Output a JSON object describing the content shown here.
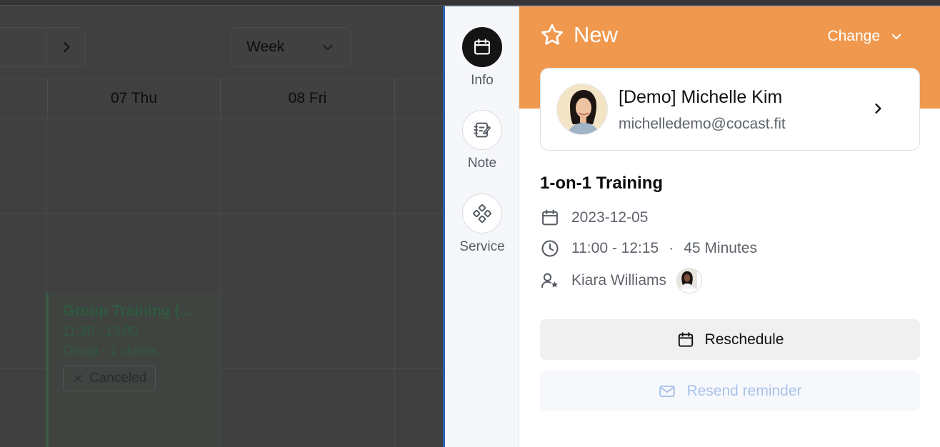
{
  "background": {
    "week_label": "Week",
    "days": [
      "07 Thu",
      "08 Fri"
    ],
    "event": {
      "title": "Group Training (...",
      "time": "11:30 - 13:00",
      "group": "Group - 1 clients",
      "badge": "Canceled"
    }
  },
  "rail": {
    "items": [
      {
        "label": "Info",
        "icon": "calendar-icon"
      },
      {
        "label": "Note",
        "icon": "note-icon"
      },
      {
        "label": "Service",
        "icon": "service-icon"
      }
    ]
  },
  "header": {
    "status": "New",
    "change_label": "Change",
    "accent": "#f0984e"
  },
  "client": {
    "name": "[Demo] Michelle Kim",
    "email": "michelledemo@cocast.fit"
  },
  "appointment": {
    "service": "1-on-1 Training",
    "date": "2023-12-05",
    "time_range": "11:00 - 12:15",
    "duration": "45 Minutes",
    "separator": "·",
    "staff": "Kiara Williams"
  },
  "actions": {
    "reschedule": "Reschedule",
    "resend": "Resend reminder"
  }
}
